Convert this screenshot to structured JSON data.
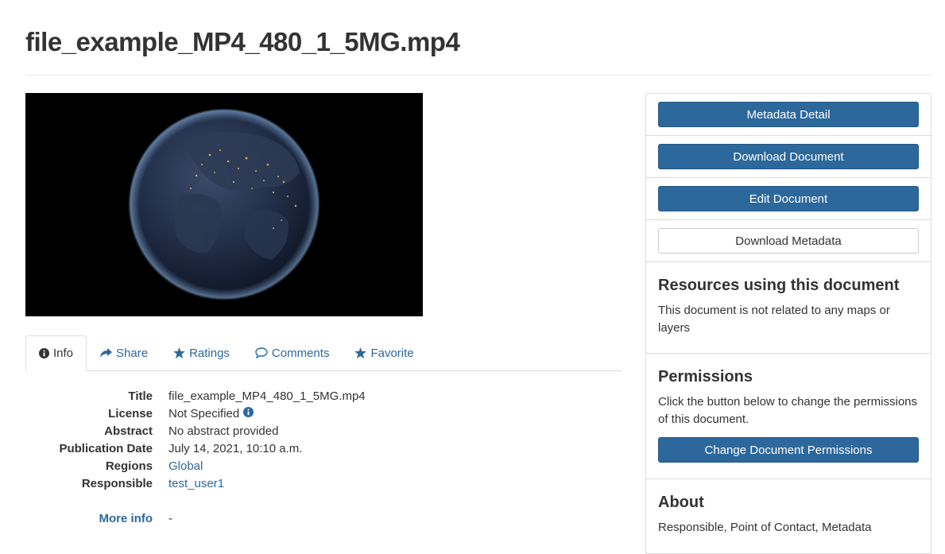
{
  "page": {
    "title": "file_example_MP4_480_1_5MG.mp4"
  },
  "tabs": [
    {
      "label": "Info",
      "icon": "info-circle-icon"
    },
    {
      "label": "Share",
      "icon": "share-icon"
    },
    {
      "label": "Ratings",
      "icon": "star-icon"
    },
    {
      "label": "Comments",
      "icon": "comment-icon"
    },
    {
      "label": "Favorite",
      "icon": "star-icon"
    }
  ],
  "info": {
    "title_label": "Title",
    "title_value": "file_example_MP4_480_1_5MG.mp4",
    "license_label": "License",
    "license_value": "Not Specified",
    "abstract_label": "Abstract",
    "abstract_value": "No abstract provided",
    "pubdate_label": "Publication Date",
    "pubdate_value": "July 14, 2021, 10:10 a.m.",
    "regions_label": "Regions",
    "regions_value": "Global",
    "responsible_label": "Responsible",
    "responsible_value": "test_user1",
    "more_info_label": "More info",
    "more_info_value": "-"
  },
  "sidebar": {
    "metadata_detail": "Metadata Detail",
    "download_document": "Download Document",
    "edit_document": "Edit Document",
    "download_metadata": "Download Metadata",
    "resources_heading": "Resources using this document",
    "resources_text": "This document is not related to any maps or layers",
    "permissions_heading": "Permissions",
    "permissions_text": "Click the button below to change the permissions of this document.",
    "change_permissions": "Change Document Permissions",
    "about_heading": "About",
    "about_text": "Responsible, Point of Contact, Metadata"
  },
  "colors": {
    "primary": "#2c689c",
    "link": "#2c689c",
    "border": "#dddddd",
    "text": "#333333"
  }
}
